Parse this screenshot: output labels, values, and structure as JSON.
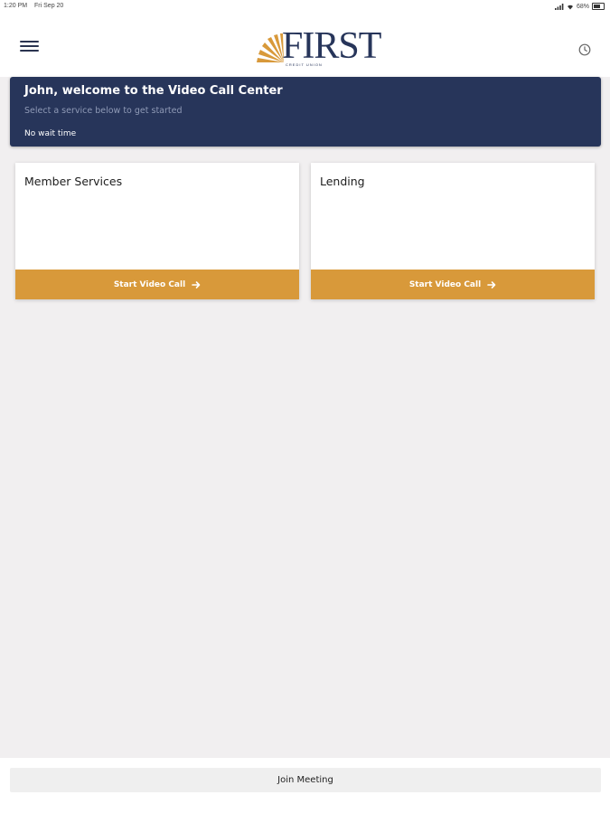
{
  "status_bar": {
    "time": "1:20 PM",
    "date": "Fri Sep 20",
    "battery": "68%"
  },
  "header": {
    "logo_text": "FIRST",
    "logo_subtext": "CREDIT UNION",
    "menu_icon": "hamburger-icon",
    "history_icon": "clock-icon"
  },
  "banner": {
    "title": "John, welcome to the Video Call Center",
    "subtitle": "Select a service below to get started",
    "wait_time": "No wait time"
  },
  "services": [
    {
      "title": "Member Services",
      "button_label": "Start Video Call"
    },
    {
      "title": "Lending",
      "button_label": "Start Video Call"
    }
  ],
  "footer": {
    "join_label": "Join Meeting"
  },
  "colors": {
    "navy": "#27355a",
    "accent_gold": "#d8993a",
    "background": "#f1eff0"
  }
}
